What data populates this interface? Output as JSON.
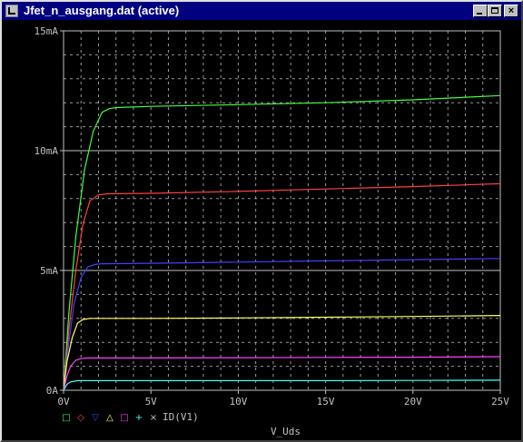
{
  "window": {
    "title": "Jfet_n_ausgang.dat (active)",
    "buttons": {
      "minimize": "_",
      "maximize": "□",
      "close": "×"
    }
  },
  "colors": {
    "background": "#000000",
    "axis": "#c0c0c0",
    "grid": "#c0c0c0",
    "tick_label": "#c0c0c0",
    "series": [
      "#40ff40",
      "#ff4040",
      "#4040ff",
      "#ffff60",
      "#ff40ff",
      "#40ffff"
    ]
  },
  "chart_data": {
    "type": "line",
    "title": "",
    "xlabel": "V_Uds",
    "ylabel": "",
    "xlim": [
      0,
      25
    ],
    "ylim": [
      0,
      15
    ],
    "x_unit": "V",
    "y_unit": "mA",
    "x_ticks": [
      0,
      5,
      10,
      15,
      20,
      25
    ],
    "x_tick_labels": [
      "0V",
      "5V",
      "10V",
      "15V",
      "20V",
      "25V"
    ],
    "y_ticks": [
      0,
      5,
      10,
      15
    ],
    "y_tick_labels": [
      "0A",
      "5mA",
      "10mA",
      "15mA"
    ],
    "grid": true,
    "legend": {
      "markers": [
        "□",
        "◇",
        "▽",
        "△",
        "□",
        "+",
        "×"
      ],
      "label": "ID(V1)"
    },
    "series": [
      {
        "x": [
          0,
          0.3,
          0.7,
          1.2,
          1.7,
          2.2,
          2.6,
          3,
          5,
          10,
          15,
          20,
          25
        ],
        "values": [
          0,
          3.2,
          6.4,
          9.2,
          10.8,
          11.6,
          11.75,
          11.8,
          11.85,
          11.92,
          12.0,
          12.12,
          12.3
        ]
      },
      {
        "x": [
          0,
          0.3,
          0.7,
          1.1,
          1.5,
          2.0,
          2.5,
          5,
          10,
          15,
          20,
          25
        ],
        "values": [
          0,
          2.5,
          5.0,
          6.9,
          7.9,
          8.15,
          8.2,
          8.22,
          8.3,
          8.4,
          8.5,
          8.62
        ]
      },
      {
        "x": [
          0,
          0.3,
          0.6,
          1.0,
          1.4,
          1.8,
          2.2,
          5,
          10,
          15,
          20,
          25
        ],
        "values": [
          0,
          2.0,
          3.6,
          4.7,
          5.15,
          5.25,
          5.28,
          5.3,
          5.35,
          5.4,
          5.45,
          5.5
        ]
      },
      {
        "x": [
          0,
          0.2,
          0.5,
          0.8,
          1.1,
          1.5,
          5,
          10,
          15,
          20,
          25
        ],
        "values": [
          0,
          1.2,
          2.2,
          2.8,
          2.95,
          3.0,
          3.0,
          3.02,
          3.05,
          3.08,
          3.12
        ]
      },
      {
        "x": [
          0,
          0.2,
          0.4,
          0.7,
          1.0,
          1.4,
          5,
          10,
          15,
          20,
          25
        ],
        "values": [
          0,
          0.6,
          1.0,
          1.25,
          1.32,
          1.35,
          1.35,
          1.36,
          1.37,
          1.38,
          1.4
        ]
      },
      {
        "x": [
          0,
          0.2,
          0.4,
          0.8,
          5,
          10,
          15,
          20,
          25
        ],
        "values": [
          0,
          0.25,
          0.35,
          0.4,
          0.4,
          0.4,
          0.4,
          0.41,
          0.42
        ]
      }
    ]
  }
}
